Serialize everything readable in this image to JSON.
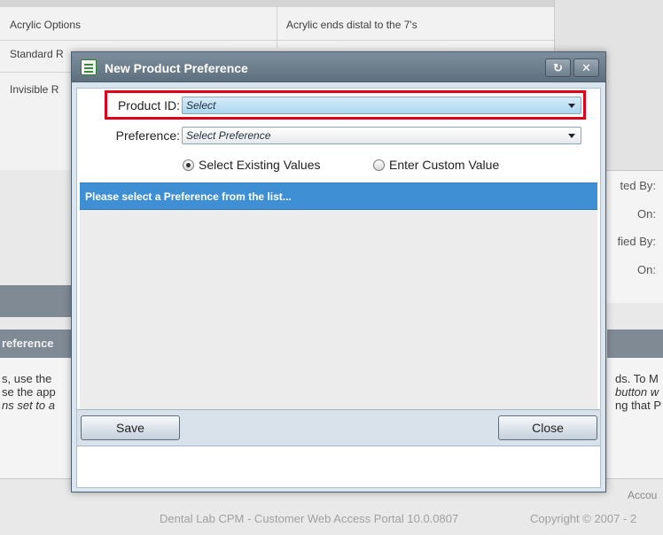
{
  "background": {
    "grid_rows": [
      {
        "col1": "Acrylic Options",
        "col2": "Acrylic ends distal to the 7's"
      },
      {
        "col1": "Standard R",
        "col2": ""
      },
      {
        "col1": "Invisible R",
        "col2": ""
      }
    ],
    "right_labels": [
      "ted By:",
      "On:",
      "fied By:",
      "On:"
    ],
    "section_header": "reference",
    "help_left_lines": [
      "s, use the",
      "se the app",
      "ns set to a"
    ],
    "help_right_lines": [
      "ds. To M",
      "button w",
      "ng that P"
    ],
    "footer_right_label": "Accou",
    "footer_text": "Dental Lab CPM - Customer Web Access Portal 10.0.0807",
    "footer_copyright": "Copyright © 2007 - 2"
  },
  "dialog": {
    "title": "New Product Preference",
    "refresh_icon": "refresh-icon",
    "close_icon": "close-icon",
    "product_id": {
      "label": "Product ID:",
      "value": "Select"
    },
    "preference": {
      "label": "Preference:",
      "value": "Select Preference"
    },
    "radio_existing": "Select Existing Values",
    "radio_custom": "Enter Custom Value",
    "list_header": "Please select a Preference from the list...",
    "save_label": "Save",
    "close_label": "Close"
  },
  "colors": {
    "accent_blue": "#3e8fd4",
    "highlight_red": "#e0001a",
    "title_bar": "#6e7f8d"
  }
}
